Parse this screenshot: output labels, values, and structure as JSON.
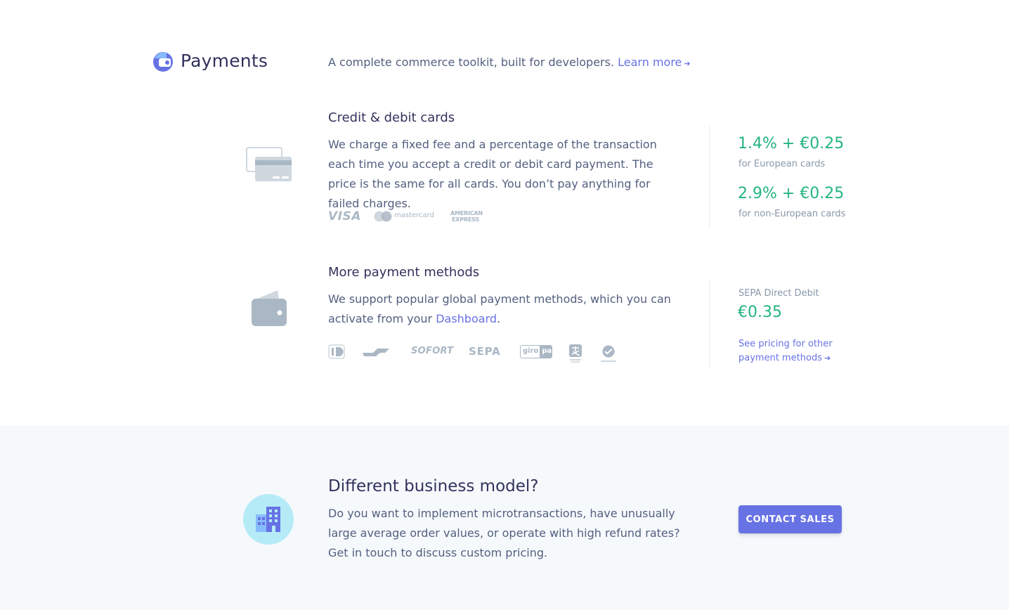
{
  "header": {
    "title": "Payments",
    "tagline": "A complete commerce toolkit, built for developers.",
    "learn_more": "Learn more"
  },
  "cards": {
    "title": "Credit & debit cards",
    "description": "We charge a fixed fee and a percentage of the transaction each time you accept a credit or debit card payment. The price is the same for all cards. You don’t pay anything for failed charges.",
    "brands": [
      "VISA",
      "mastercard",
      "AMERICAN",
      "EXPRESS"
    ],
    "pricing": [
      {
        "price": "1.4% + €0.25",
        "note": "for European cards"
      },
      {
        "price": "2.9% + €0.25",
        "note": "for non-European cards"
      }
    ]
  },
  "methods": {
    "title": "More payment methods",
    "description_prefix": "We support popular global payment methods, which you can activate from your",
    "dashboard_link": "Dashboard",
    "description_suffix": ".",
    "logos": [
      "SOFORT",
      "SEPA",
      "giro",
      "pay"
    ],
    "sepa_label": "SEPA Direct Debit",
    "sepa_price": "€0.35",
    "see_pricing": "See pricing for other payment methods"
  },
  "cta": {
    "title": "Different business model?",
    "description": "Do you want to implement microtransactions, have unusually large average order values, or operate with high refund rates? Get in touch to discuss custom pricing.",
    "button": "CONTACT SALES"
  },
  "colors": {
    "accent": "#6772e5",
    "price_green": "#24b47e",
    "heading": "#32325d",
    "body_text": "#525f7f",
    "band_bg": "#f6f9fc"
  }
}
